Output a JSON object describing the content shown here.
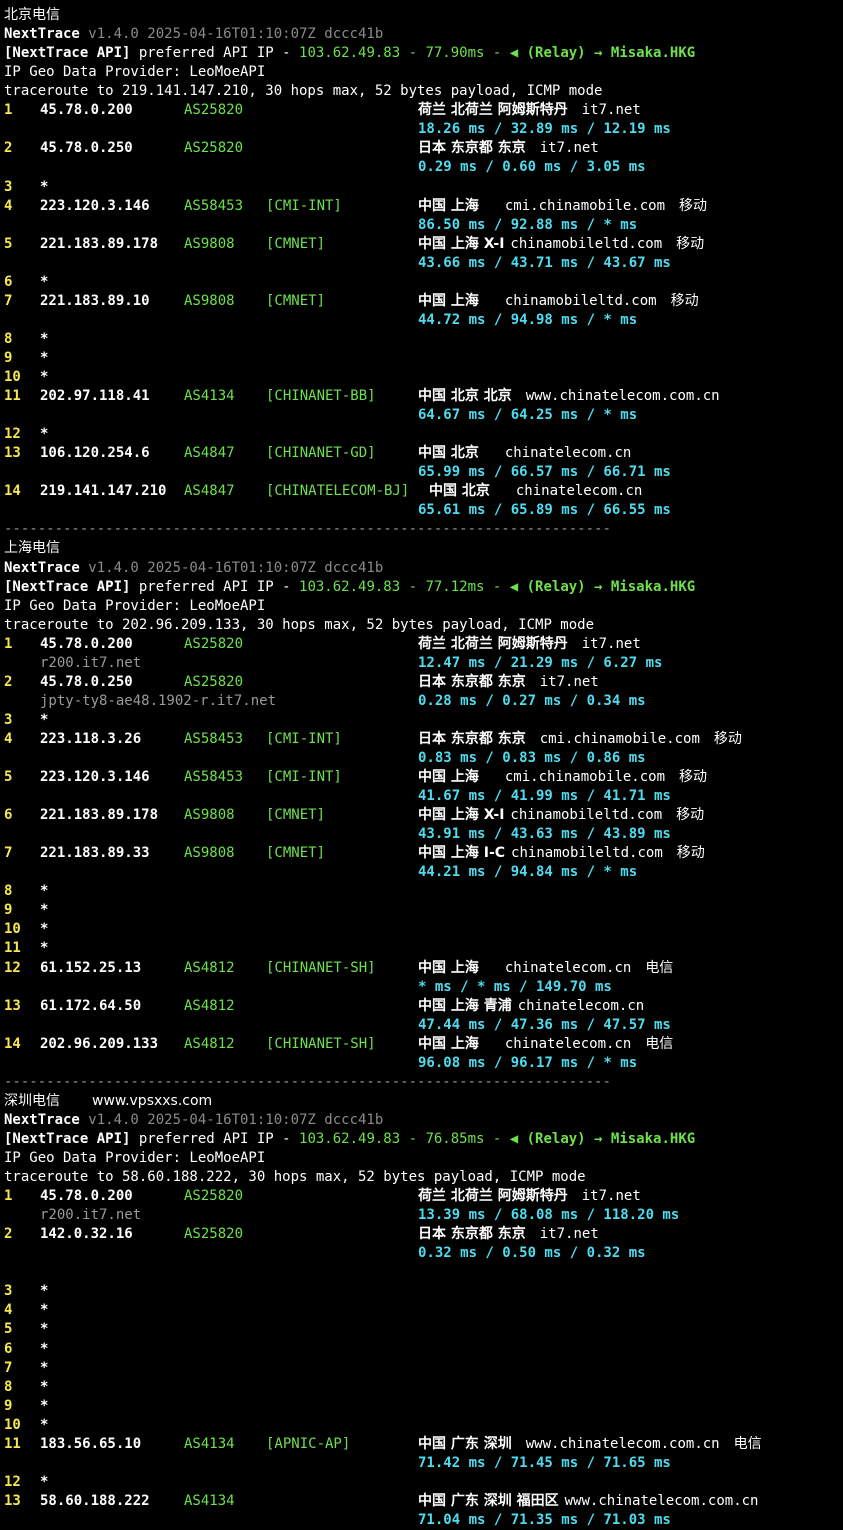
{
  "sections": [
    {
      "title": "北京电信",
      "watermark": "",
      "header_name": "NextTrace",
      "header_ver": " v1.4.0 2025-04-16T01:10:07Z dccc41b",
      "api_tag": "[NextTrace API]",
      "api_mid": " preferred API IP - ",
      "api_val": "103.62.49.83 - 77.90ms - ",
      "api_icon": "◀",
      "api_tail": " (Relay) → Misaka.HKG",
      "provider": "IP Geo Data Provider: LeoMoeAPI",
      "traceroute": "traceroute to 219.141.147.210, 30 hops max, 52 bytes payload, ICMP mode",
      "hops": [
        {
          "n": "1",
          "ip": "45.78.0.200",
          "as": "AS25820",
          "tag": "",
          "geo": "荷兰 北荷兰 阿姆斯特丹",
          "domain": "it7.net",
          "isp": "",
          "lat": "18.26 ms / 32.89 ms / 12.19 ms"
        },
        {
          "n": "2",
          "ip": "45.78.0.250",
          "as": "AS25820",
          "tag": "",
          "geo": "日本 东京都 东京",
          "domain": "it7.net",
          "isp": "",
          "lat": "0.29 ms / 0.60 ms / 3.05 ms"
        },
        {
          "n": "3",
          "star": true
        },
        {
          "n": "4",
          "ip": "223.120.3.146",
          "as": "AS58453",
          "tag": "[CMI-INT]",
          "geo": "中国 上海",
          "domain": "cmi.chinamobile.com",
          "isp": "移动",
          "lat": "86.50 ms / 92.88 ms / * ms"
        },
        {
          "n": "5",
          "ip": "221.183.89.178",
          "as": "AS9808",
          "tag": "[CMNET]",
          "geo": "中国 上海 X-I",
          "domain": "chinamobileltd.com",
          "isp": "移动",
          "lat": "43.66 ms / 43.71 ms / 43.67 ms"
        },
        {
          "n": "6",
          "star": true
        },
        {
          "n": "7",
          "ip": "221.183.89.10",
          "as": "AS9808",
          "tag": "[CMNET]",
          "geo": "中国 上海",
          "domain": "chinamobileltd.com",
          "isp": "移动",
          "lat": "44.72 ms / 94.98 ms / * ms"
        },
        {
          "n": "8",
          "star": true
        },
        {
          "n": "9",
          "star": true
        },
        {
          "n": "10",
          "star": true
        },
        {
          "n": "11",
          "ip": "202.97.118.41",
          "as": "AS4134",
          "tag": "[CHINANET-BB]",
          "geo": "中国 北京 北京",
          "domain": "www.chinatelecom.com.cn",
          "isp": "",
          "lat": "64.67 ms / 64.25 ms / * ms"
        },
        {
          "n": "12",
          "star": true
        },
        {
          "n": "13",
          "ip": "106.120.254.6",
          "as": "AS4847",
          "tag": "[CHINANET-GD]",
          "geo": "中国 北京",
          "domain": "chinatelecom.cn",
          "isp": "",
          "lat": "65.99 ms / 66.57 ms / 66.71 ms"
        },
        {
          "n": "14",
          "ip": "219.141.147.210",
          "as": "AS4847",
          "tag": "[CHINATELECOM-BJ]",
          "geo": "中国 北京",
          "domain": "chinatelecom.cn",
          "isp": "",
          "lat": "65.61 ms / 65.89 ms / 66.55 ms",
          "wide": true
        }
      ]
    },
    {
      "title": "上海电信",
      "watermark": "",
      "header_name": "NextTrace",
      "header_ver": " v1.4.0 2025-04-16T01:10:07Z dccc41b",
      "api_tag": "[NextTrace API]",
      "api_mid": " preferred API IP - ",
      "api_val": "103.62.49.83 - 77.12ms - ",
      "api_icon": "◀",
      "api_tail": " (Relay) → Misaka.HKG",
      "provider": "IP Geo Data Provider: LeoMoeAPI",
      "traceroute": "traceroute to 202.96.209.133, 30 hops max, 52 bytes payload, ICMP mode",
      "hops": [
        {
          "n": "1",
          "ip": "45.78.0.200",
          "as": "AS25820",
          "tag": "",
          "geo": "荷兰 北荷兰 阿姆斯特丹",
          "domain": "it7.net",
          "isp": "",
          "lat": "12.47 ms / 21.29 ms / 6.27 ms",
          "rdns": "r200.it7.net"
        },
        {
          "n": "2",
          "ip": "45.78.0.250",
          "as": "AS25820",
          "tag": "",
          "geo": "日本 东京都 东京",
          "domain": "it7.net",
          "isp": "",
          "lat": "0.28 ms / 0.27 ms / 0.34 ms",
          "rdns": "jpty-ty8-ae48.1902-r.it7.net"
        },
        {
          "n": "3",
          "star": true
        },
        {
          "n": "4",
          "ip": "223.118.3.26",
          "as": "AS58453",
          "tag": "[CMI-INT]",
          "geo": "日本 东京都 东京",
          "domain": "cmi.chinamobile.com",
          "isp": "移动",
          "lat": "0.83 ms / 0.83 ms / 0.86 ms"
        },
        {
          "n": "5",
          "ip": "223.120.3.146",
          "as": "AS58453",
          "tag": "[CMI-INT]",
          "geo": "中国 上海",
          "domain": "cmi.chinamobile.com",
          "isp": "移动",
          "lat": "41.67 ms / 41.99 ms / 41.71 ms"
        },
        {
          "n": "6",
          "ip": "221.183.89.178",
          "as": "AS9808",
          "tag": "[CMNET]",
          "geo": "中国 上海 X-I",
          "domain": "chinamobileltd.com",
          "isp": "移动",
          "lat": "43.91 ms / 43.63 ms / 43.89 ms"
        },
        {
          "n": "7",
          "ip": "221.183.89.33",
          "as": "AS9808",
          "tag": "[CMNET]",
          "geo": "中国 上海 I-C",
          "domain": "chinamobileltd.com",
          "isp": "移动",
          "lat": "44.21 ms / 94.84 ms / * ms"
        },
        {
          "n": "8",
          "star": true
        },
        {
          "n": "9",
          "star": true
        },
        {
          "n": "10",
          "star": true
        },
        {
          "n": "11",
          "star": true
        },
        {
          "n": "12",
          "ip": "61.152.25.13",
          "as": "AS4812",
          "tag": "[CHINANET-SH]",
          "geo": "中国 上海",
          "domain": "chinatelecom.cn",
          "isp": "电信",
          "lat": "* ms / * ms / 149.70 ms"
        },
        {
          "n": "13",
          "ip": "61.172.64.50",
          "as": "AS4812",
          "tag": "",
          "geo": "中国 上海 青浦",
          "domain": "chinatelecom.cn",
          "isp": "",
          "lat": "47.44 ms / 47.36 ms / 47.57 ms"
        },
        {
          "n": "14",
          "ip": "202.96.209.133",
          "as": "AS4812",
          "tag": "[CHINANET-SH]",
          "geo": "中国 上海",
          "domain": "chinatelecom.cn",
          "isp": "电信",
          "lat": "96.08 ms / 96.17 ms / * ms"
        }
      ]
    },
    {
      "title": "深圳电信",
      "watermark": "www.vpsxxs.com",
      "header_name": "NextTrace",
      "header_ver": " v1.4.0 2025-04-16T01:10:07Z dccc41b",
      "api_tag": "[NextTrace API]",
      "api_mid": " preferred API IP - ",
      "api_val": "103.62.49.83 - 76.85ms - ",
      "api_icon": "◀",
      "api_tail": " (Relay) → Misaka.HKG",
      "provider": "IP Geo Data Provider: LeoMoeAPI",
      "traceroute": "traceroute to 58.60.188.222, 30 hops max, 52 bytes payload, ICMP mode",
      "hops": [
        {
          "n": "1",
          "ip": "45.78.0.200",
          "as": "AS25820",
          "tag": "",
          "geo": "荷兰 北荷兰 阿姆斯特丹",
          "domain": "it7.net",
          "isp": "",
          "lat": "13.39 ms / 68.08 ms / 118.20 ms",
          "rdns": "r200.it7.net"
        },
        {
          "n": "2",
          "ip": "142.0.32.16",
          "as": "AS25820",
          "tag": "",
          "geo": "日本 东京都 东京",
          "domain": "it7.net",
          "isp": "",
          "lat": "0.32 ms / 0.50 ms / 0.32 ms",
          "extra_blank": true
        },
        {
          "n": "3",
          "star": true
        },
        {
          "n": "4",
          "star": true
        },
        {
          "n": "5",
          "star": true
        },
        {
          "n": "6",
          "star": true
        },
        {
          "n": "7",
          "star": true
        },
        {
          "n": "8",
          "star": true
        },
        {
          "n": "9",
          "star": true
        },
        {
          "n": "10",
          "star": true
        },
        {
          "n": "11",
          "ip": "183.56.65.10",
          "as": "AS4134",
          "tag": "[APNIC-AP]",
          "geo": "中国 广东 深圳",
          "domain": "www.chinatelecom.com.cn",
          "isp": "电信",
          "lat": "71.42 ms / 71.45 ms / 71.65 ms"
        },
        {
          "n": "12",
          "star": true
        },
        {
          "n": "13",
          "ip": "58.60.188.222",
          "as": "AS4134",
          "tag": "",
          "geo": "中国 广东 深圳 福田区",
          "domain": "www.chinatelecom.com.cn",
          "isp": "",
          "lat": "71.04 ms / 71.35 ms / 71.03 ms"
        }
      ]
    }
  ],
  "separator": "------------------------------------------------------------------------",
  "colors": {
    "bg": "#000000",
    "green": "#6ee04e",
    "cyan": "#4fdcef",
    "yellow": "#f6e84e",
    "grey": "#9a9a9a"
  }
}
